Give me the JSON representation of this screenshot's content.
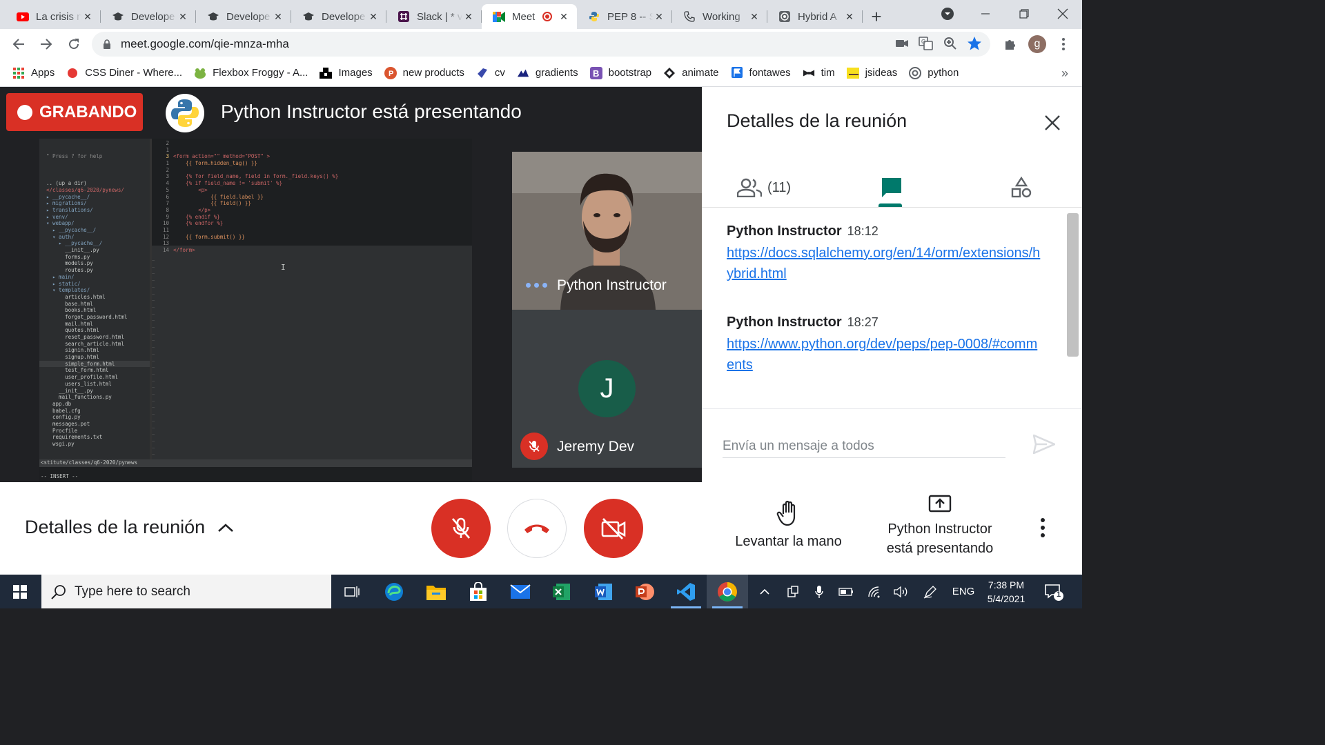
{
  "browser": {
    "tabs": [
      {
        "title": "La crisis n",
        "icon": "youtube-icon",
        "active": false
      },
      {
        "title": "Develope",
        "icon": "graduation-cap-icon",
        "active": false
      },
      {
        "title": "Develope",
        "icon": "graduation-cap-icon",
        "active": false
      },
      {
        "title": "Develope",
        "icon": "graduation-cap-icon",
        "active": false
      },
      {
        "title": "Slack | * v",
        "icon": "slack-icon",
        "active": false
      },
      {
        "title": "Meet",
        "icon": "meet-icon",
        "active": true
      },
      {
        "title": "PEP 8 -- S",
        "icon": "python-icon",
        "active": false
      },
      {
        "title": "Working",
        "icon": "phone-icon",
        "active": false
      },
      {
        "title": "Hybrid A",
        "icon": "target-icon",
        "active": false
      }
    ],
    "new_tab": "+",
    "url": "meet.google.com/qie-mnza-mha",
    "profile_initial": "g",
    "bookmarks": [
      {
        "label": "Apps",
        "icon": "apps-grid-icon"
      },
      {
        "label": "CSS Diner - Where...",
        "icon": "css-diner-icon"
      },
      {
        "label": "Flexbox Froggy - A...",
        "icon": "frog-icon"
      },
      {
        "label": "Images",
        "icon": "images-icon"
      },
      {
        "label": "new products",
        "icon": "product-hunt-icon"
      },
      {
        "label": "cv",
        "icon": "cv-icon"
      },
      {
        "label": "gradients",
        "icon": "gradients-icon"
      },
      {
        "label": "bootstrap",
        "icon": "bootstrap-icon"
      },
      {
        "label": "animate",
        "icon": "animate-icon"
      },
      {
        "label": "fontawes",
        "icon": "flag-icon"
      },
      {
        "label": "tim",
        "icon": "bowtie-icon"
      },
      {
        "label": "jsideas",
        "icon": "jsideas-icon"
      },
      {
        "label": "python",
        "icon": "python-bookmark-icon"
      }
    ],
    "bookmarks_more": "»"
  },
  "meet": {
    "recording_label": "GRABANDO",
    "presenting_title": "Python Instructor está presentando",
    "shared_screen": {
      "tree_header": "\" Press ? for help",
      "tree_lines": [
        {
          "t": "",
          "k": "f"
        },
        {
          "t": ".. (up a dir)",
          "k": "f"
        },
        {
          "t": "</classes/q6-2020/pynews/",
          "k": "ca"
        },
        {
          "t": "▸ __pycache__/",
          "k": "d"
        },
        {
          "t": "▸ migrations/",
          "k": "d"
        },
        {
          "t": "▸ translations/",
          "k": "d"
        },
        {
          "t": "▸ venv/",
          "k": "d"
        },
        {
          "t": "▾ webapp/",
          "k": "d"
        },
        {
          "t": "  ▸ __pycache__/",
          "k": "d"
        },
        {
          "t": "  ▾ auth/",
          "k": "d"
        },
        {
          "t": "    ▸ __pycache__/",
          "k": "d"
        },
        {
          "t": "      __init__.py",
          "k": "f"
        },
        {
          "t": "      forms.py",
          "k": "f"
        },
        {
          "t": "      models.py",
          "k": "f"
        },
        {
          "t": "      routes.py",
          "k": "f"
        },
        {
          "t": "  ▸ main/",
          "k": "d"
        },
        {
          "t": "  ▸ static/",
          "k": "d"
        },
        {
          "t": "  ▾ templates/",
          "k": "d"
        },
        {
          "t": "      articles.html",
          "k": "f"
        },
        {
          "t": "      base.html",
          "k": "f"
        },
        {
          "t": "      books.html",
          "k": "f"
        },
        {
          "t": "      forgot_password.html",
          "k": "f"
        },
        {
          "t": "      mail.html",
          "k": "f"
        },
        {
          "t": "      quotes.html",
          "k": "f"
        },
        {
          "t": "      reset_password.html",
          "k": "f"
        },
        {
          "t": "      search_article.html",
          "k": "f"
        },
        {
          "t": "      signin.html",
          "k": "f"
        },
        {
          "t": "      signup.html",
          "k": "f"
        },
        {
          "t": "      simple_form.html",
          "k": "f",
          "sel": true
        },
        {
          "t": "      test_form.html",
          "k": "f"
        },
        {
          "t": "      user_profile.html",
          "k": "f"
        },
        {
          "t": "      users_list.html",
          "k": "f"
        },
        {
          "t": "    __init__.py",
          "k": "f"
        },
        {
          "t": "    mail_functions.py",
          "k": "f"
        },
        {
          "t": "  app.db",
          "k": "f"
        },
        {
          "t": "  babel.cfg",
          "k": "f"
        },
        {
          "t": "  config.py",
          "k": "f"
        },
        {
          "t": "  messages.pot",
          "k": "f"
        },
        {
          "t": "  Procfile",
          "k": "f"
        },
        {
          "t": "  requirements.txt",
          "k": "f"
        },
        {
          "t": "  wsgi.py",
          "k": "f"
        }
      ],
      "gutter": [
        "2",
        "1",
        "3",
        "1",
        "2",
        "3",
        "4",
        "5",
        "6",
        "7",
        "8",
        "9",
        "10",
        "11",
        "12",
        "13",
        "14"
      ],
      "code_lines": [
        "",
        "",
        "<form action=\"\" method=\"POST\" >",
        "    {{ form.hidden_tag() }}",
        "",
        "    {% for field_name, field in form._field.keys() %}",
        "    {% if field_name != 'submit' %}",
        "        <p>",
        "            {{ field.label }}",
        "            {{ field() }}",
        "        </p>",
        "    {% endif %}",
        "    {% endfor %}",
        "",
        "    {{ form.submit() }}",
        "",
        "</form>"
      ],
      "status_line": "<stitute/classes/q6-2020/pynews",
      "mode_line": "-- INSERT --"
    },
    "participants": [
      {
        "name": "Python Instructor",
        "speaking": true
      },
      {
        "name": "Jeremy Dev",
        "initial": "J",
        "muted": true
      }
    ]
  },
  "panel": {
    "title": "Detalles de la reunión",
    "people_count": "(11)",
    "messages": [
      {
        "sender": "Python Instructor",
        "time": "18:12",
        "link": "https://docs.sqlalchemy.org/en/14/orm/extensions/hybrid.html"
      },
      {
        "sender": "Python Instructor",
        "time": "18:27",
        "link": "https://www.python.org/dev/peps/pep-0008/#comments"
      }
    ],
    "compose_placeholder": "Envía un mensaje a todos"
  },
  "bottom_bar": {
    "details_label": "Detalles de la reunión",
    "raise_hand_label": "Levantar la mano",
    "presenting_line1": "Python Instructor",
    "presenting_line2": "está presentando"
  },
  "taskbar": {
    "search_placeholder": "Type here to search",
    "language": "ENG",
    "time": "7:38 PM",
    "date": "5/4/2021",
    "notification_count": "1"
  },
  "colors": {
    "meet_red": "#d93025",
    "meet_teal": "#00796b",
    "link_blue": "#1a73e8",
    "stage_bg": "#202124"
  }
}
